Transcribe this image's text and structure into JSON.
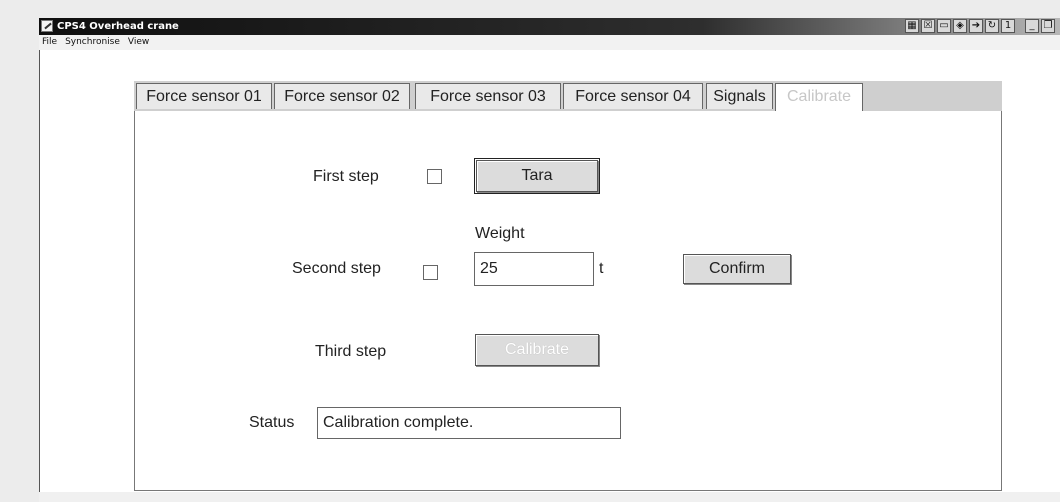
{
  "window": {
    "title": "CPS4 Overhead crane",
    "toolbar_icons": [
      "grid-icon",
      "crossed-box-icon",
      "monitor-icon",
      "diamond-arrow-icon",
      "page-arrow-icon",
      "refresh-icon",
      "number-one-icon"
    ],
    "window_controls": [
      "minimize-icon",
      "restore-icon"
    ]
  },
  "menu": {
    "items": [
      "File",
      "Synchronise",
      "View"
    ]
  },
  "tabs": [
    {
      "label": "Force sensor 01",
      "state": "normal"
    },
    {
      "label": "Force sensor 02",
      "state": "normal"
    },
    {
      "label": "Force sensor 03",
      "state": "normal"
    },
    {
      "label": "Force sensor 04",
      "state": "normal"
    },
    {
      "label": "Signals",
      "state": "normal"
    },
    {
      "label": "Calibrate",
      "state": "active-disabled"
    }
  ],
  "calibrate": {
    "step1": {
      "label": "First step",
      "checked": false,
      "button": "Tara"
    },
    "step2": {
      "label": "Second step",
      "checked": false,
      "weight_label": "Weight",
      "weight_value": "25",
      "unit": "t",
      "button": "Confirm"
    },
    "step3": {
      "label": "Third step",
      "button": "Calibrate"
    },
    "status": {
      "label": "Status",
      "value": "Calibration complete."
    }
  }
}
